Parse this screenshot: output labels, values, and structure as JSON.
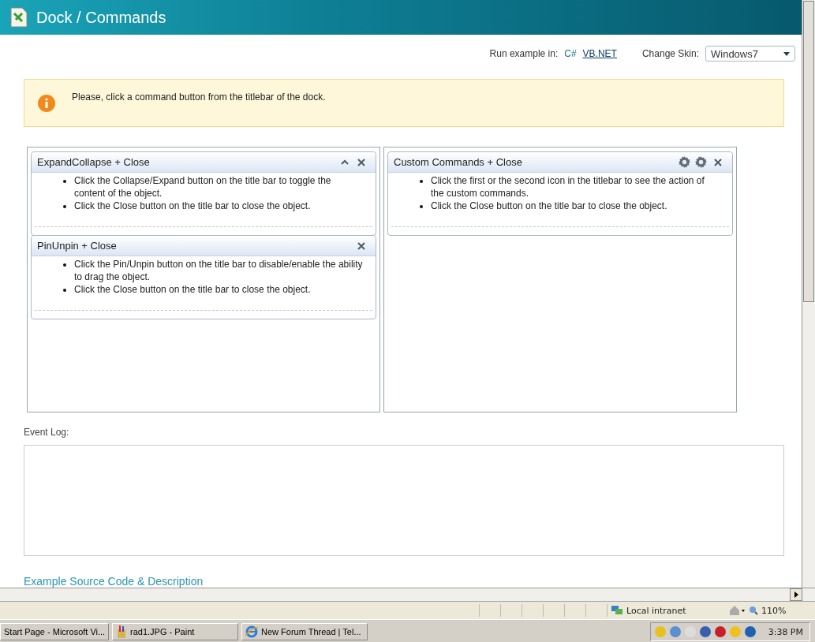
{
  "header": {
    "title": "Dock / Commands"
  },
  "run_example": {
    "label": "Run example in:",
    "languages": [
      {
        "label": "C#",
        "selected": true
      },
      {
        "label": "VB.NET",
        "selected": false
      }
    ]
  },
  "skin": {
    "label": "Change Skin:",
    "value": "Windows7"
  },
  "info": {
    "message": "Please, click a command button from the titlebar of the dock."
  },
  "zones": [
    {
      "docks": [
        {
          "title": "ExpandCollapse + Close",
          "commands": [
            {
              "kind": "collapse"
            },
            {
              "kind": "close"
            }
          ],
          "items": [
            "Click the Collapse/Expand button on the title bar to toggle the content of the object.",
            "Click the Close button on the title bar to close the object."
          ]
        },
        {
          "title": "PinUnpin + Close",
          "commands": [
            {
              "kind": "close"
            }
          ],
          "items": [
            "Click the Pin/Unpin button on the title bar to disable/enable the ability to drag the object.",
            "Click the Close button on the title bar to close the object."
          ]
        }
      ]
    },
    {
      "docks": [
        {
          "title": "Custom Commands + Close",
          "commands": [
            {
              "kind": "gear"
            },
            {
              "kind": "gear"
            },
            {
              "kind": "close"
            }
          ],
          "items": [
            "Click the first or the second icon in the titlebar to see the action of the custom commands.",
            "Click the Close button on the title bar to close the object."
          ]
        }
      ]
    }
  ],
  "event_log": {
    "label": "Event Log:"
  },
  "source_link": "Example Source Code & Description",
  "status_bar": {
    "zone": "Local intranet",
    "zoom": "110%"
  },
  "taskbar": {
    "buttons": [
      {
        "label": "Start Page - Microsoft Vi..."
      },
      {
        "label": "rad1.JPG - Paint"
      },
      {
        "label": "New Forum Thread | Tel..."
      }
    ],
    "time": "3:38 PM"
  }
}
